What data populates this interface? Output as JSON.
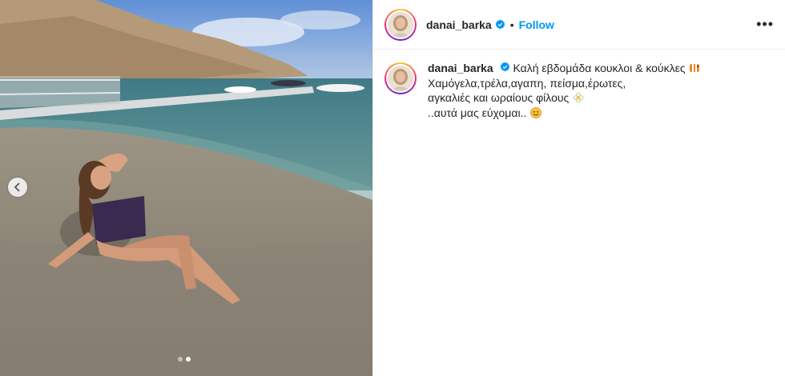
{
  "post": {
    "username": "danai_barka",
    "follow_label": "Follow",
    "separator": "•",
    "more_label": "•••"
  },
  "caption": {
    "username": "danai_barka",
    "line1": "Καλή εβδομάδα κουκλοι & κούκλες",
    "line2": "Χαμόγελα,τρέλα,αγαπη, πείσμα,έρωτες,",
    "line3": "αγκαλιές και ωραίους φίλους",
    "line4": "..αυτά μας εύχομαι.."
  },
  "carousel": {
    "slide_count": 2,
    "active_index": 1
  },
  "colors": {
    "follow": "#0095f6",
    "verified": "#0095f6",
    "text": "#262626"
  },
  "icons": {
    "prev": "chevron-left-icon",
    "verified": "verified-badge-icon",
    "more": "more-options-icon"
  }
}
